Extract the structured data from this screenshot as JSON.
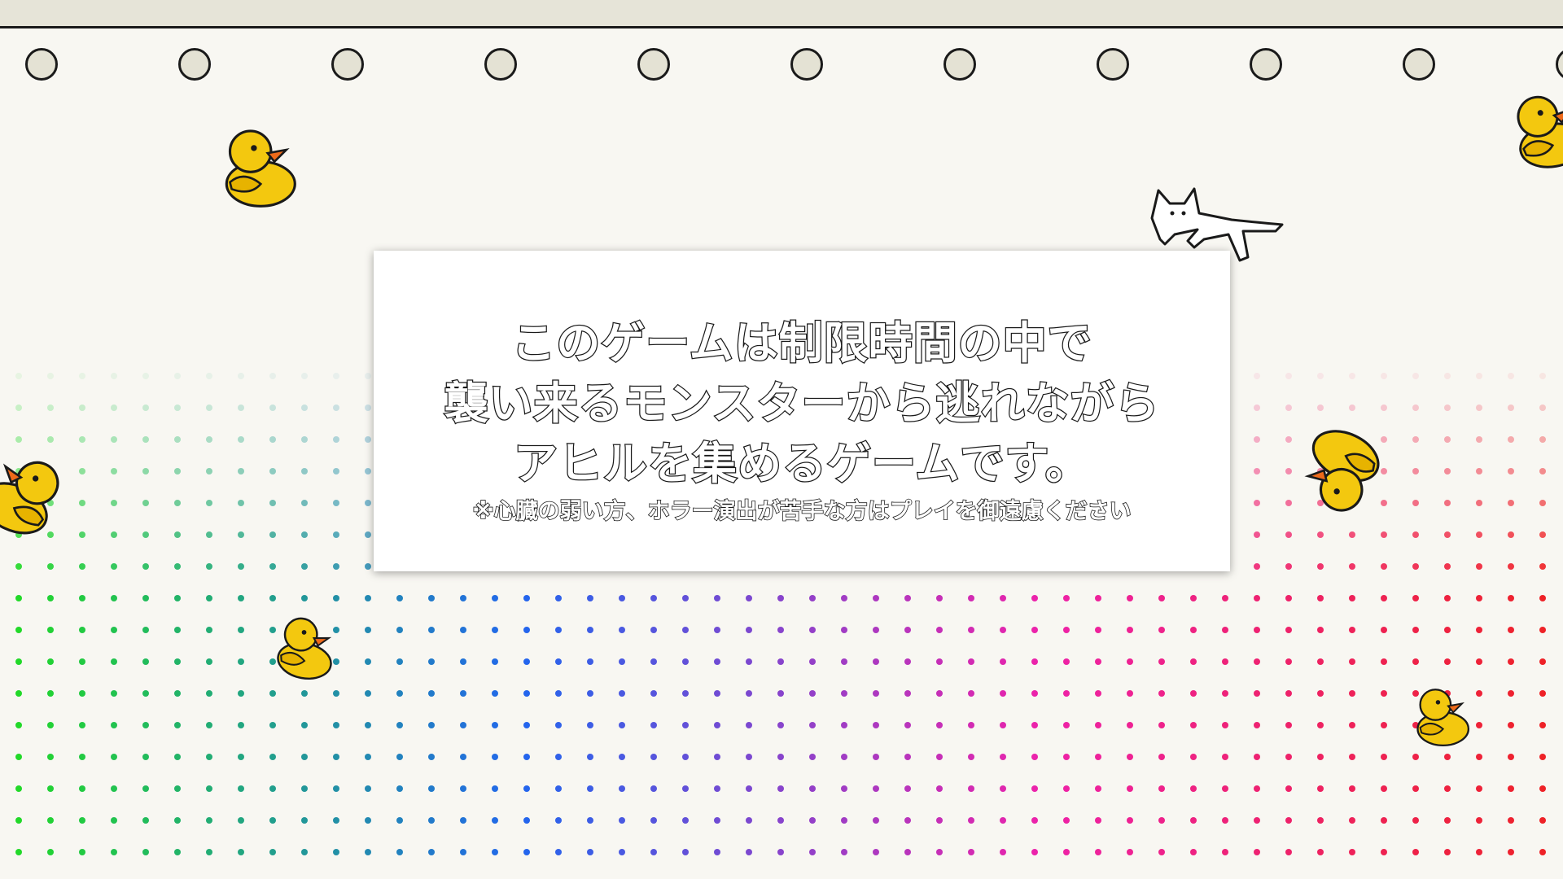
{
  "notice": {
    "lines": [
      "このゲームは制限時間の中で",
      "襲い来るモンスターから逃れながら",
      "アヒルを集めるゲームです。"
    ],
    "warning": "※心臓の弱い方、ホラー演出が苦手な方はプレイを御遠慮ください"
  },
  "scene": {
    "background_color": "#f8f7f2",
    "strip_color": "#e6e4d8",
    "hole_count": 11,
    "dot_gradient_colors": [
      "#22dd22",
      "#2266ee",
      "#ee22aa",
      "#ee2222"
    ],
    "duck_count": 6,
    "sprites": [
      "duck-sprite",
      "cat-monster-sprite"
    ]
  }
}
